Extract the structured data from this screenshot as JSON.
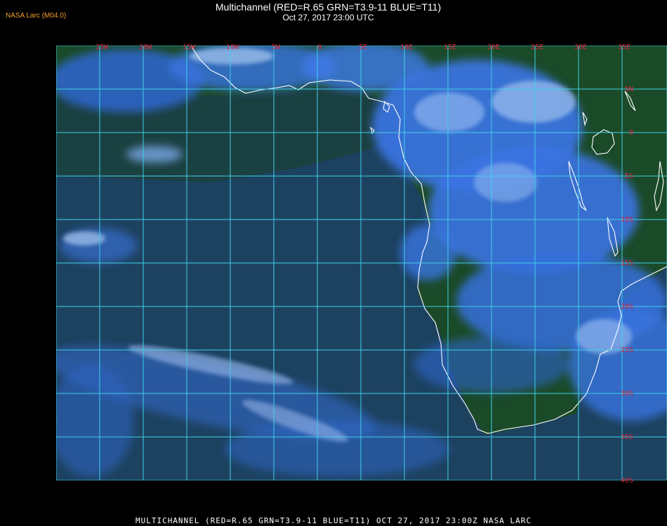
{
  "credit": "NASA Larc (M04.0)",
  "title": "Multichannel (RED=R.65 GRN=T3.9-11 BLUE=T11)",
  "subtitle": "Oct 27, 2017 23:00 UTC",
  "footer": "MULTICHANNEL (RED=R.65 GRN=T3.9-11 BLUE=T11) OCT 27, 2017 23:00Z   NASA LARC",
  "map": {
    "longitude_labels": [
      "25W",
      "20W",
      "15W",
      "10W",
      "5W",
      "0",
      "5E",
      "10E",
      "15E",
      "20E",
      "25E",
      "30E",
      "35E"
    ],
    "latitude_labels": [
      "5N",
      "0",
      "5S",
      "10S",
      "15S",
      "20S",
      "25S",
      "30S",
      "35S",
      "40S"
    ],
    "colors": {
      "grid": "#3fd0e8",
      "labels": "#e0243a",
      "coast": "#ffffff",
      "land_background": "#1c4a2a",
      "ocean": "#1e4460",
      "cloud": "#3a78e8",
      "high_cloud": "#a8c8f0"
    }
  }
}
